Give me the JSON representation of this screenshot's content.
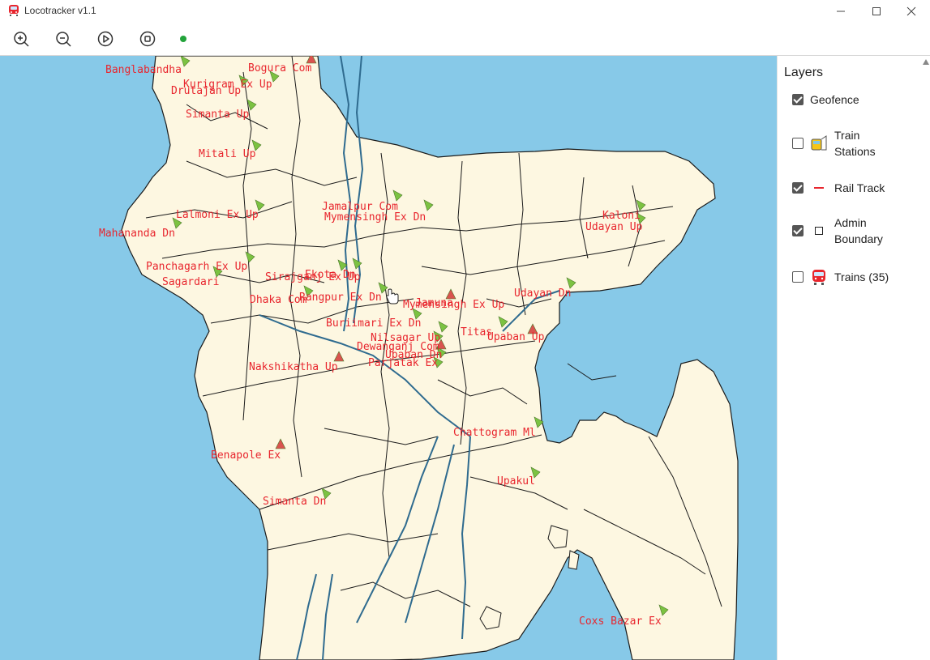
{
  "window": {
    "title": "Locotracker v1.1"
  },
  "toolbar": {
    "zoom_in": "zoom-in-icon",
    "zoom_out": "zoom-out-icon",
    "play": "play-icon",
    "stop": "stop-icon",
    "status_color": "#22a33a"
  },
  "colors": {
    "sea": "#87c9e8",
    "land": "#fdf7e1",
    "border": "#1a1a1a",
    "river": "#2f6b8f",
    "label": "#e8262e",
    "train_up": "#7cc242",
    "train_dn": "#d9534f"
  },
  "layers": {
    "title": "Layers",
    "items": [
      {
        "label": "Geofence",
        "checked": true,
        "icon": ""
      },
      {
        "label": "Train Stations",
        "checked": false,
        "icon": "train-station-icon"
      },
      {
        "label": "Rail Track",
        "checked": true,
        "icon": "rail-track-icon"
      },
      {
        "label": "Admin Boundary",
        "checked": true,
        "icon": "admin-boundary-icon"
      },
      {
        "label": "Trains (35)",
        "checked": false,
        "icon": "train-icon"
      }
    ]
  },
  "trains": [
    {
      "label": "Banglabandha",
      "dir": "up"
    },
    {
      "label": "Bogura Com",
      "dir": "dn"
    },
    {
      "label": "Kurigram Ex Up",
      "dir": "up"
    },
    {
      "label": "Drutajan Up",
      "dir": "up"
    },
    {
      "label": "Simanta Up",
      "dir": "up"
    },
    {
      "label": "Mitali Up",
      "dir": "up"
    },
    {
      "label": "Jamalpur Com",
      "dir": "up"
    },
    {
      "label": "Mymensingh Ex Dn",
      "dir": "up"
    },
    {
      "label": "Lalmoni Ex Up",
      "dir": "up"
    },
    {
      "label": "Kaloni",
      "dir": "up"
    },
    {
      "label": "Udayan Up",
      "dir": "up"
    },
    {
      "label": "Mahananda Dn",
      "dir": "up"
    },
    {
      "label": "Panchagarh Ex Up",
      "dir": "up"
    },
    {
      "label": "Sagardari",
      "dir": "up"
    },
    {
      "label": "Sirajganj Ex Up",
      "dir": "up"
    },
    {
      "label": "Ekota Dn",
      "dir": "up"
    },
    {
      "label": "Rangpur Ex Dn",
      "dir": "up"
    },
    {
      "label": "Dhaka Com",
      "dir": "up"
    },
    {
      "label": "Mymensingh Ex Up",
      "dir": "dn"
    },
    {
      "label": "Jamuna",
      "dir": "up"
    },
    {
      "label": "Udayan Dn",
      "dir": "up"
    },
    {
      "label": "Buriimari Ex Dn",
      "dir": "up"
    },
    {
      "label": "Nilsagar Up",
      "dir": "up"
    },
    {
      "label": "Titas",
      "dir": "up"
    },
    {
      "label": "Upaban Up",
      "dir": "dn"
    },
    {
      "label": "Dewanganj Com",
      "dir": "dn"
    },
    {
      "label": "Upaban Dn",
      "dir": "up"
    },
    {
      "label": "Parjatak Ex",
      "dir": "up"
    },
    {
      "label": "Nakshikatha Up",
      "dir": "dn"
    },
    {
      "label": "Chattogram Ml",
      "dir": "up"
    },
    {
      "label": "Benapole Ex",
      "dir": "dn"
    },
    {
      "label": "Upakul",
      "dir": "up"
    },
    {
      "label": "Simanta Dn",
      "dir": "up"
    },
    {
      "label": "Coxs Bazar Ex",
      "dir": "up"
    }
  ]
}
